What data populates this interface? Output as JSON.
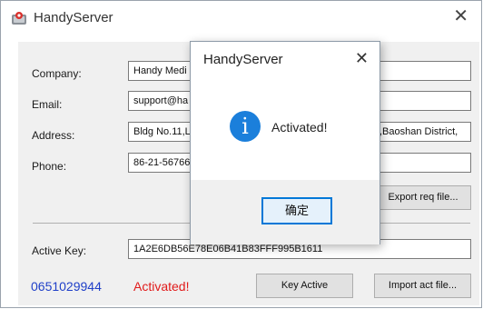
{
  "window": {
    "title": "HandyServer",
    "icon": "app-logo-icon",
    "close_glyph": "✕"
  },
  "form": {
    "company_label": "Company:",
    "company_value": "Handy Medi",
    "email_label": "Email:",
    "email_value": "support@ha",
    "address_label": "Address:",
    "address_value_left": "Bldg No.11,L",
    "address_value_right": ",Baoshan District,",
    "phone_label": "Phone:",
    "phone_value": "86-21-56766",
    "active_key_label": "Active Key:",
    "active_key_value": "1A2E6DB56E78E06B41B83FFF995B1611"
  },
  "buttons": {
    "export": "Export req file...",
    "key_active": "Key Active",
    "import": "Import act file..."
  },
  "status": {
    "serial": "0651029944",
    "message": "Activated!"
  },
  "dialog": {
    "title": "HandyServer",
    "close_glyph": "✕",
    "info_glyph": "i",
    "message": "Activated!",
    "ok_label": "确定"
  },
  "colors": {
    "serial": "#2040c8",
    "status": "#e11b1b",
    "info_icon": "#1b7fdb",
    "default_button_border": "#0078d7"
  }
}
